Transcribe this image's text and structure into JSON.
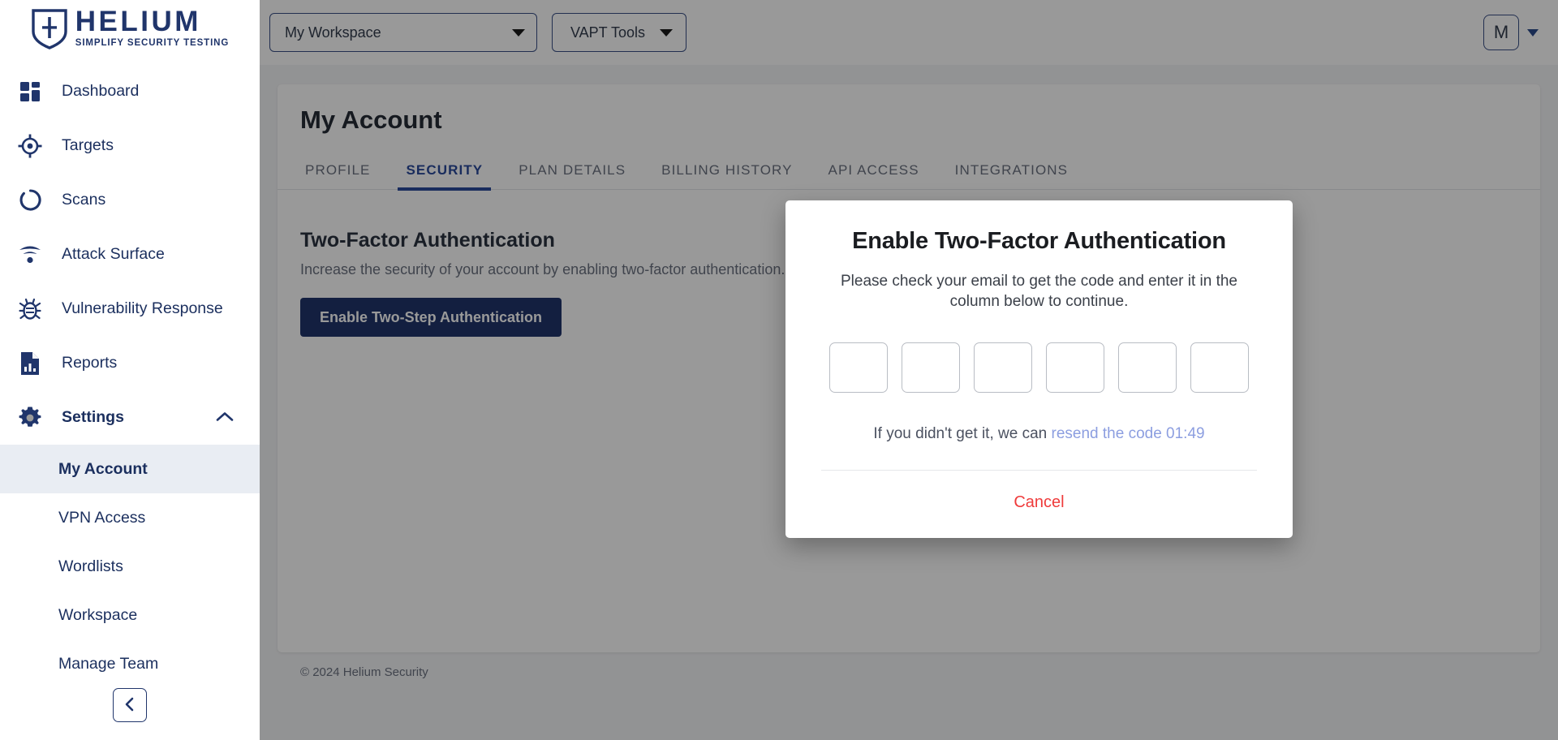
{
  "brand": {
    "name": "HELIUM",
    "tagline": "SIMPLIFY SECURITY TESTING",
    "logo_color": "#20356b"
  },
  "sidebar": {
    "items": [
      {
        "label": "Dashboard",
        "icon": "dashboard-grid-icon"
      },
      {
        "label": "Targets",
        "icon": "target-crosshair-icon"
      },
      {
        "label": "Scans",
        "icon": "scan-circle-icon"
      },
      {
        "label": "Attack Surface",
        "icon": "wifi-signal-icon"
      },
      {
        "label": "Vulnerability Response",
        "icon": "bug-icon"
      },
      {
        "label": "Reports",
        "icon": "report-document-icon"
      },
      {
        "label": "Settings",
        "icon": "gear-icon"
      }
    ],
    "settings_submenu": [
      {
        "label": "My Account",
        "selected": true
      },
      {
        "label": "VPN Access",
        "selected": false
      },
      {
        "label": "Wordlists",
        "selected": false
      },
      {
        "label": "Workspace",
        "selected": false
      },
      {
        "label": "Manage Team",
        "selected": false
      }
    ],
    "collapse_icon": "chevron-left-icon"
  },
  "topbar": {
    "workspace_value": "My Workspace",
    "workspace_caret_icon": "caret-down-icon",
    "vapt_tools_label": "VAPT Tools",
    "vapt_caret_icon": "caret-down-icon",
    "avatar_initial": "M",
    "avatar_caret_icon": "caret-down-icon"
  },
  "page": {
    "title": "My Account",
    "tabs": [
      {
        "label": "PROFILE",
        "active": false
      },
      {
        "label": "SECURITY",
        "active": true
      },
      {
        "label": "PLAN DETAILS",
        "active": false
      },
      {
        "label": "BILLING HISTORY",
        "active": false
      },
      {
        "label": "API ACCESS",
        "active": false
      },
      {
        "label": "INTEGRATIONS",
        "active": false
      }
    ],
    "section": {
      "heading": "Two-Factor Authentication",
      "description": "Increase the security of your account by enabling two-factor authentication.",
      "button_label": "Enable Two-Step Authentication"
    },
    "footer": "© 2024 Helium Security"
  },
  "modal": {
    "title": "Enable Two-Factor Authentication",
    "description": "Please check your email to get the code and enter it in the column below to continue.",
    "otp_values": [
      "",
      "",
      "",
      "",
      "",
      ""
    ],
    "otp_count": 6,
    "resend_prefix": "If you didn't get it, we can ",
    "resend_link": "resend the code 01:49",
    "cancel_label": "Cancel",
    "cancel_color": "#ef3b3b",
    "link_color": "#8c9ee0"
  }
}
